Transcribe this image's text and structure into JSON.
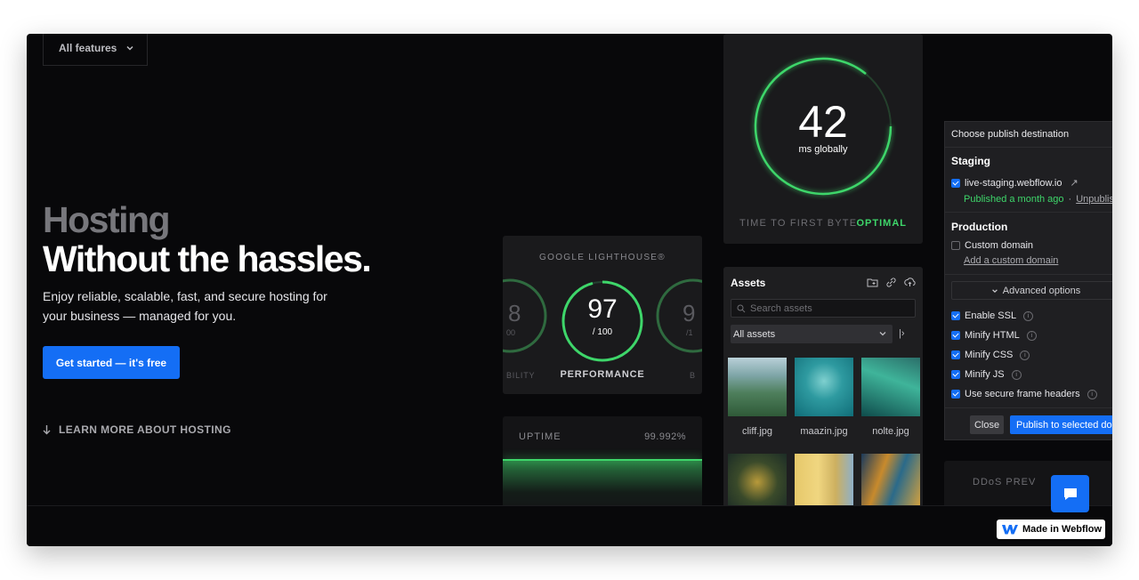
{
  "nav": {
    "features_label": "All features"
  },
  "hero": {
    "title_line1": "Hosting",
    "title_line2": "Without the hassles.",
    "subtitle": "Enjoy reliable, scalable, fast, and secure hosting for your business — managed for you.",
    "cta_label": "Get started — it's free",
    "learn_more_label": "LEARN MORE ABOUT HOSTING"
  },
  "ttfb": {
    "value": "42",
    "unit": "ms globally",
    "label": "TIME TO FIRST BYTE",
    "status": "OPTIMAL",
    "status_color": "#3ed66a"
  },
  "lighthouse": {
    "title": "GOOGLE LIGHTHOUSE®",
    "score": "97",
    "score_max": "/ 100",
    "category": "PERFORMANCE",
    "left_partial_score": "8",
    "left_partial_sub": "00",
    "left_partial_label": "BILITY",
    "right_partial_score": "9",
    "right_partial_sub": "/1",
    "right_partial_label": "B"
  },
  "uptime": {
    "label": "UPTIME",
    "value": "99.992%"
  },
  "assets": {
    "title": "Assets",
    "search_placeholder": "Search assets",
    "filter_value": "All assets",
    "collapse_glyph": "|›",
    "files": [
      {
        "name": "cliff.jpg"
      },
      {
        "name": "maazin.jpg"
      },
      {
        "name": "nolte.jpg"
      }
    ]
  },
  "publish": {
    "header": "Choose publish destination",
    "staging_title": "Staging",
    "staging_domain": "live-staging.webflow.io",
    "staging_domain_icon": "↗",
    "staging_status": "Published a month ago",
    "staging_separator": "·",
    "unpublish_label": "Unpublish",
    "production_title": "Production",
    "custom_domain_label": "Custom domain",
    "add_domain_label": "Add a custom domain",
    "advanced_label": "Advanced options",
    "info_glyph": "i",
    "options": [
      {
        "label": "Enable SSL",
        "checked": true
      },
      {
        "label": "Minify HTML",
        "checked": true
      },
      {
        "label": "Minify CSS",
        "checked": true
      },
      {
        "label": "Minify JS",
        "checked": true
      },
      {
        "label": "Use secure frame headers",
        "checked": true
      }
    ],
    "close_label": "Close",
    "publish_label": "Publish to selected domains"
  },
  "ddos": {
    "label": "DDoS PREV"
  },
  "badge": {
    "label": "Made in Webflow"
  },
  "colors": {
    "accent": "#146ef5",
    "success": "#3ed66a",
    "background": "#08080a"
  }
}
